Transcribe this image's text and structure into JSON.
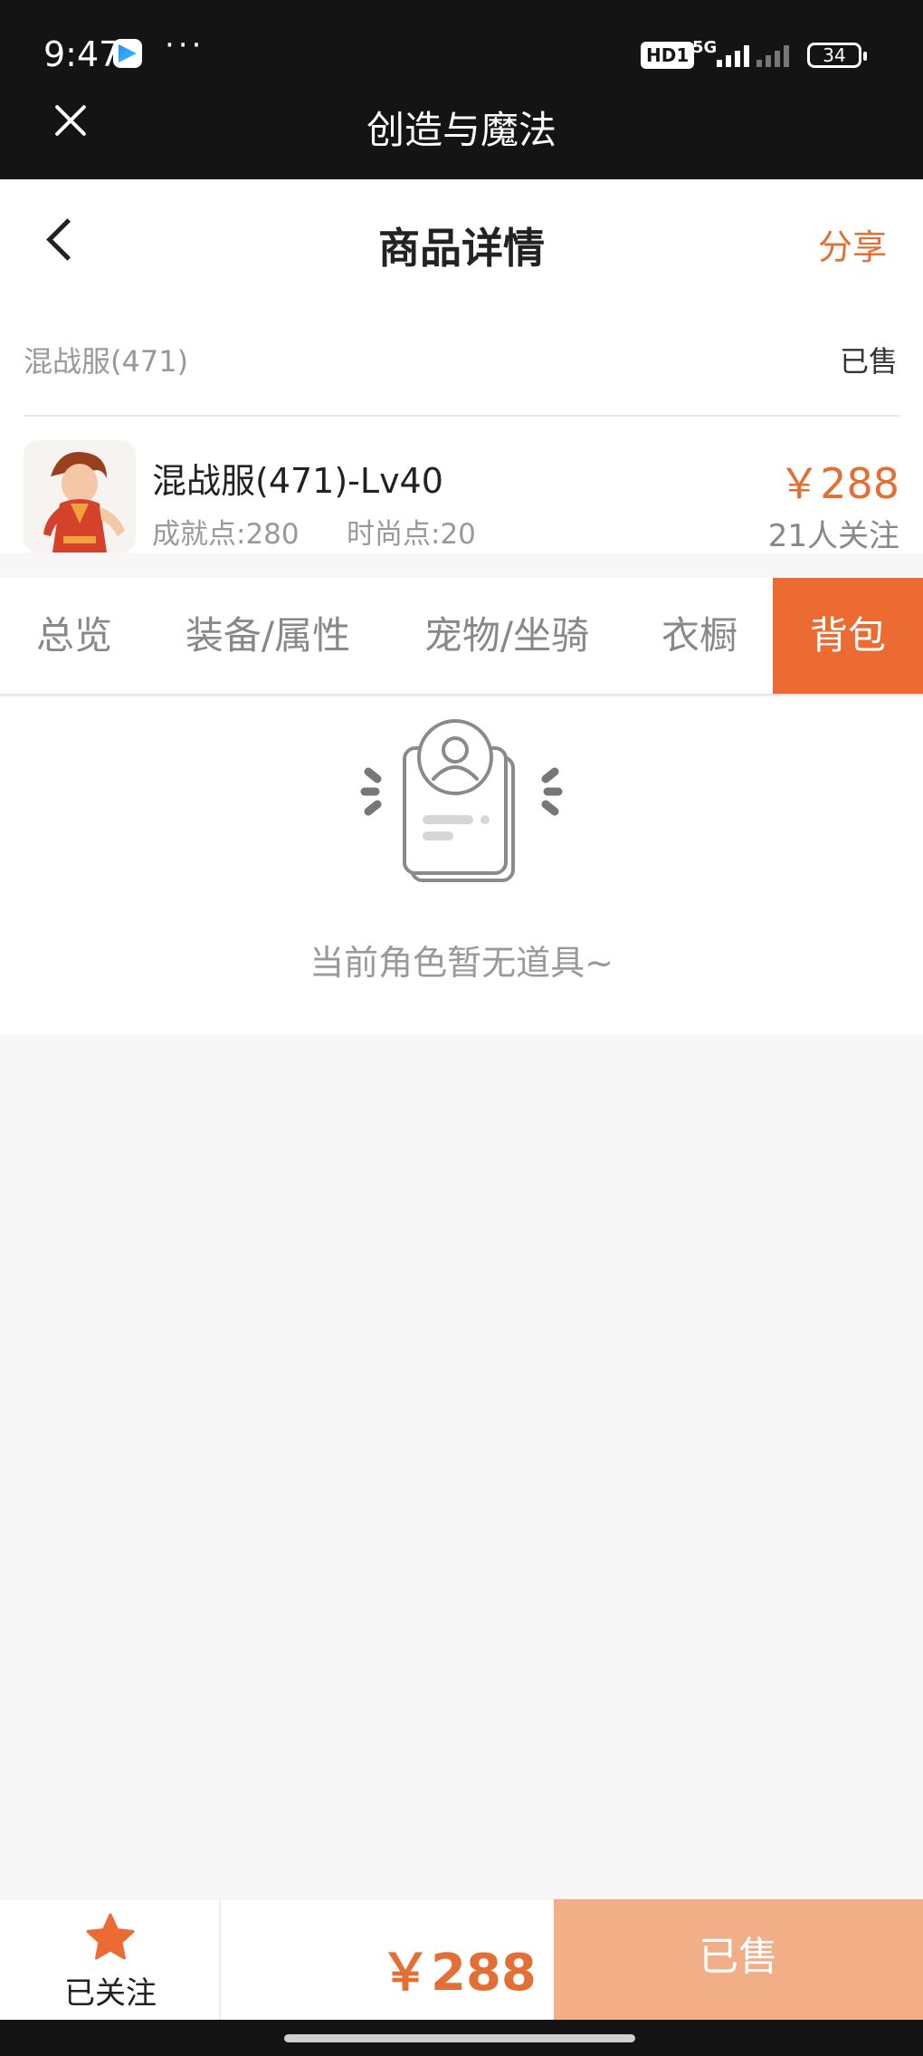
{
  "status_bar": {
    "time": "9:47",
    "more": "···",
    "hd_badge": "HD1",
    "network": "5G",
    "battery": "34"
  },
  "title_bar": {
    "app_title": "创造与魔法"
  },
  "header": {
    "title": "商品详情",
    "share_label": "分享"
  },
  "server": {
    "name": "混战服(471)",
    "status": "已售"
  },
  "product": {
    "name": "混战服(471)-Lv40",
    "achievement": "成就点:280",
    "fashion": "时尚点:20",
    "price": "￥288",
    "watchers": "21人关注"
  },
  "tabs": [
    {
      "label": "总览",
      "active": false
    },
    {
      "label": "装备/属性",
      "active": false
    },
    {
      "label": "宠物/坐骑",
      "active": false
    },
    {
      "label": "衣橱",
      "active": false
    },
    {
      "label": "背包",
      "active": true
    }
  ],
  "empty_state": {
    "text": "当前角色暂无道具~"
  },
  "bottom_bar": {
    "follow_label": "已关注",
    "price": "￥288",
    "sold_label": "已售"
  },
  "colors": {
    "accent": "#e36f35",
    "tab_active_bg": "#ec6b32",
    "sold_button_bg": "#f2ae87",
    "dark_bar": "#141414"
  }
}
